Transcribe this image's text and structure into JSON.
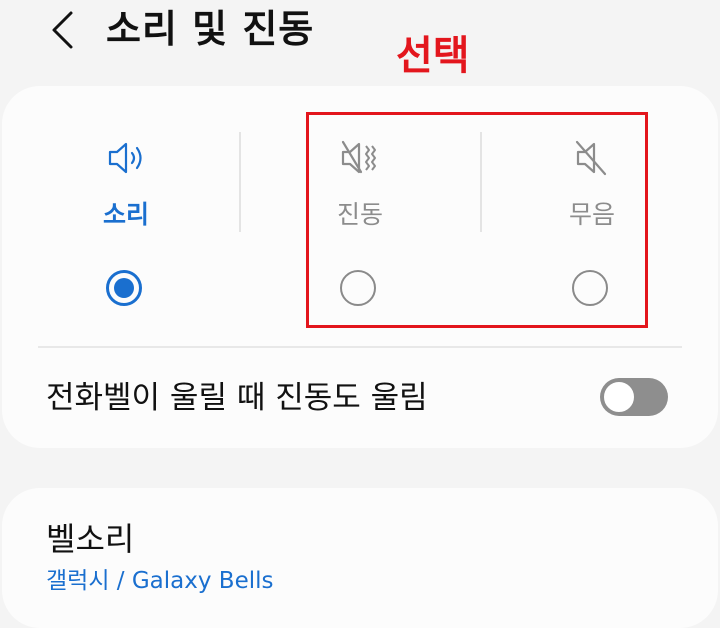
{
  "header": {
    "title": "소리 및 진동",
    "back_icon": "chevron-left-icon"
  },
  "annotation": {
    "text": "선택",
    "color": "#e3161d"
  },
  "sound_mode": {
    "options": [
      {
        "label": "소리",
        "icon": "speaker-icon",
        "selected": true
      },
      {
        "label": "진동",
        "icon": "vibrate-icon",
        "selected": false
      },
      {
        "label": "무음",
        "icon": "mute-icon",
        "selected": false
      }
    ]
  },
  "vibrate_while_ringing": {
    "label": "전화벨이 울릴 때 진동도 울림",
    "enabled": false
  },
  "ringtone": {
    "title": "벨소리",
    "value": "갤럭시 / Galaxy Bells"
  },
  "colors": {
    "accent": "#1a6fcf",
    "annotation_red": "#e3161d",
    "background": "#f4f4f4",
    "card": "#fcfcfc"
  }
}
